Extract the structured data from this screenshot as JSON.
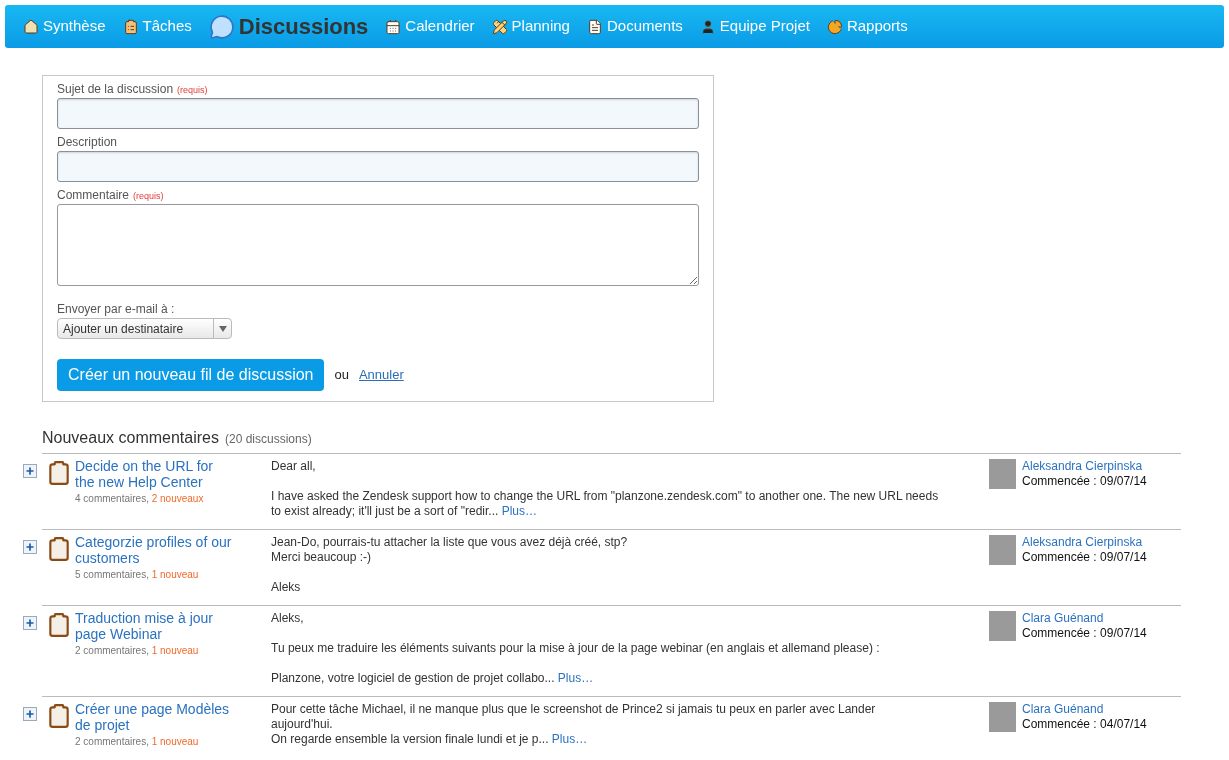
{
  "nav": [
    {
      "label": "Synthèse",
      "kind": "home",
      "selected": false
    },
    {
      "label": "Tâches",
      "kind": "clipboard",
      "selected": false
    },
    {
      "label": "Discussions",
      "kind": "bubble",
      "selected": true
    },
    {
      "label": "Calendrier",
      "kind": "calendar",
      "selected": false
    },
    {
      "label": "Planning",
      "kind": "pencil",
      "selected": false
    },
    {
      "label": "Documents",
      "kind": "document",
      "selected": false
    },
    {
      "label": "Equipe Projet",
      "kind": "person",
      "selected": false
    },
    {
      "label": "Rapports",
      "kind": "pie",
      "selected": false
    }
  ],
  "form": {
    "fields": [
      {
        "label": "Sujet de la discussion",
        "required": "(requis)",
        "kind": "input"
      },
      {
        "label": "Description",
        "kind": "input"
      },
      {
        "label": "Commentaire",
        "required": "(requis)",
        "kind": "textarea"
      }
    ],
    "email_label": "Envoyer par e-mail à :",
    "recipient_select": "Ajouter un destinataire",
    "submit": "Créer un nouveau fil de discussion",
    "or": "ou",
    "cancel": "Annuler"
  },
  "list": {
    "title": "Nouveaux commentaires",
    "count": "(20 discussions)",
    "items": [
      {
        "title": "Decide on the URL for the new Help Center",
        "comments": "4 commentaires,",
        "new": "2 nouveaux",
        "paragraphs": [
          [
            "Dear all,"
          ],
          [
            "I have asked the Zendesk support how to change the URL from \"planzone.zendesk.com\" to another one. The new URL needs",
            "to exist already; it'll just be a sort of \"redir..."
          ]
        ],
        "more": "Plus…",
        "author": "Aleksandra Cierpinska",
        "started": "Commencée : 09/07/14"
      },
      {
        "title": "Categorzie profiles of our customers",
        "comments": "5 commentaires,",
        "new": "1 nouveau",
        "paragraphs": [
          [
            "Jean-Do, pourrais-tu attacher la liste que vous avez déjà créé, stp?",
            "Merci beaucoup :-)"
          ],
          [
            "Aleks"
          ]
        ],
        "author": "Aleksandra Cierpinska",
        "started": "Commencée : 09/07/14"
      },
      {
        "title": "Traduction mise à jour page Webinar",
        "comments": "2 commentaires,",
        "new": "1 nouveau",
        "paragraphs": [
          [
            "Aleks,"
          ],
          [
            "Tu peux me traduire les éléments suivants pour la mise à jour de la page webinar (en anglais et allemand please) :"
          ],
          [
            "Planzone, votre logiciel de gestion de projet collabo..."
          ]
        ],
        "more": "Plus…",
        "author": "Clara Guénand",
        "started": "Commencée : 09/07/14"
      },
      {
        "title": "Créer une page Modèles de projet",
        "comments": "2 commentaires,",
        "new": "1 nouveau",
        "paragraphs": [
          [
            "Pour cette tâche Michael, il ne manque plus que le screenshot de Prince2 si jamais tu peux en parler avec Lander",
            "aujourd'hui.",
            "On regarde ensemble la version finale lundi et je p..."
          ]
        ],
        "more": "Plus…",
        "author": "Clara Guénand",
        "started": "Commencée : 04/07/14"
      }
    ]
  }
}
